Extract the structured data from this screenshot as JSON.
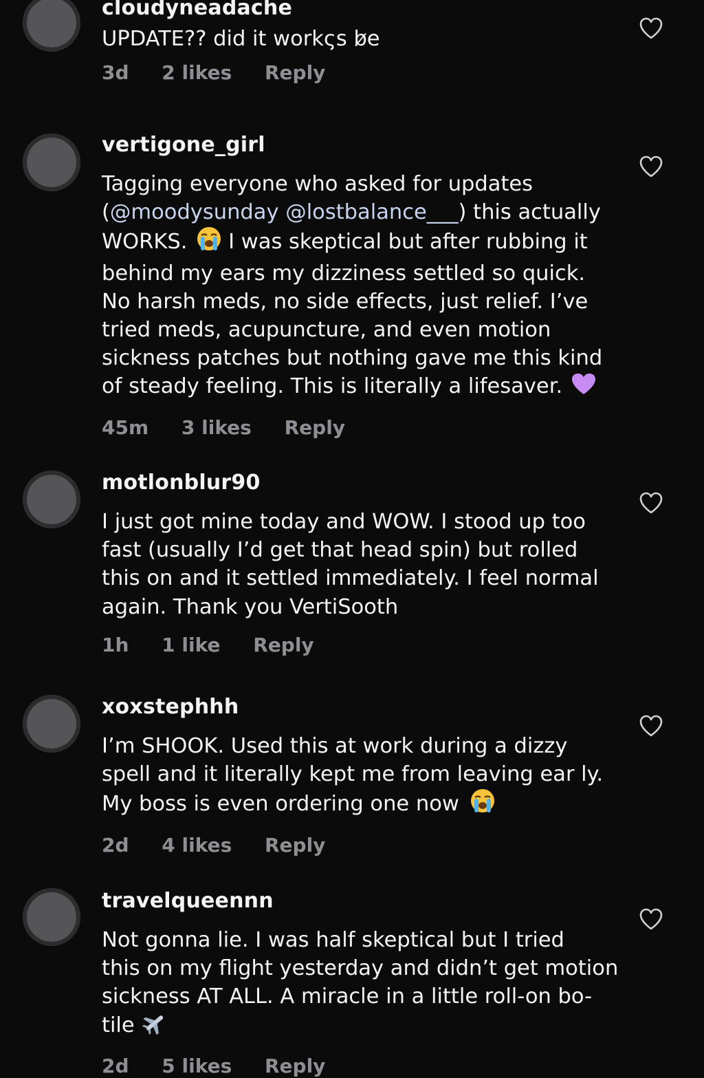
{
  "comments": [
    {
      "username": "cloudyneadache",
      "text_lines": [
        "UPDATE?? did it workςs b̷e"
      ],
      "time": "3d",
      "likes": "2 likes",
      "reply_label": "Reply"
    },
    {
      "username": "vertigone_girl",
      "text_lines": [
        "Tagging everyone who asked for updates",
        ") this actually",
        "WORKS.",
        " I was skeptical but after rubbing it",
        "behind my ears my dizziness settled so quick.",
        "No harsh meds, no side effects, just relief. I’ve",
        "tried meds, acupuncture, and even motion",
        "sickness patches but nothing gave me this kind",
        "of steady feeling. This is literally a lifesaver."
      ],
      "mentions": [
        "@moodysunday",
        "@lostbalance___"
      ],
      "time": "45m",
      "likes": "3 likes",
      "reply_label": "Reply"
    },
    {
      "username": "motlonblur90",
      "text_lines": [
        "I just got mine today and WOW. I stood up too",
        "fast (usually I’d get that head spin) but rolled",
        "this on and it settled immediately. I feel normal",
        "again. Thank you VertiSooth"
      ],
      "time": "1h",
      "likes": "1 like",
      "reply_label": "Reply"
    },
    {
      "username": "xoxstephhh",
      "text_lines": [
        "I’m SHOOK. Used this at work during a dizzy",
        "spell and it literally kept me from leaving ear ly.",
        "My boss is even ordering one now"
      ],
      "time": "2d",
      "likes": "4 likes",
      "reply_label": "Reply"
    },
    {
      "username": "travelqueennn",
      "text_lines": [
        "Not gonna lie. I was half skeptical but I tried",
        "this on my flight yesterday and didn’t get motion",
        "sickness AT ALL. A miracle in a little roll-on bo-",
        "tile"
      ],
      "time": "2d",
      "likes": "5 likes",
      "reply_label": "Reply"
    }
  ],
  "icons": {
    "like": "heart-outline-icon",
    "crying": "loudly-crying-face-emoji",
    "purple_heart": "purple-heart-emoji",
    "airplane": "airplane-emoji"
  },
  "colors": {
    "background": "#0b0b0c",
    "text": "#f4f4f4",
    "meta": "#8e8e93",
    "mention": "#c7d4ee",
    "avatar": "#555557"
  }
}
